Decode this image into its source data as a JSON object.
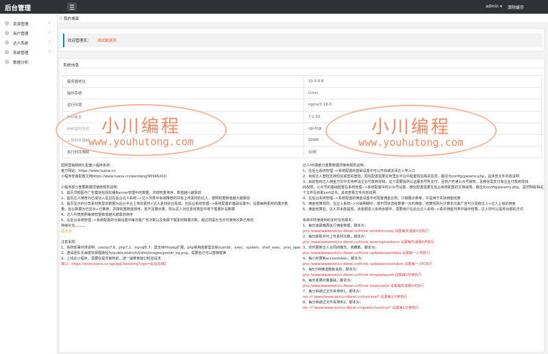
{
  "topbar": {
    "brand": "后台管理",
    "user": "admin",
    "user_caret": "▾",
    "clear_cache": "清除缓存"
  },
  "sidebar": {
    "items": [
      {
        "icon": "◎",
        "label": "资源管理",
        "arrow": "›"
      },
      {
        "icon": "◎",
        "label": "用户管理",
        "arrow": "›"
      },
      {
        "icon": "◎",
        "label": "达人系统",
        "arrow": "›"
      },
      {
        "icon": "◎",
        "label": "系统管理",
        "arrow": "›"
      },
      {
        "icon": "◎",
        "label": "数据分析",
        "arrow": ""
      }
    ]
  },
  "breadcrumb": {
    "icon": "○",
    "label": "我的桌面"
  },
  "welcome": {
    "prefix": "欢迎管理员：",
    "name": "测试数据员"
  },
  "panel": {
    "title": "系统信息",
    "table": [
      {
        "k": "服务器地址",
        "v": "10.0.0.8"
      },
      {
        "k": "操作系统",
        "v": "Linux"
      },
      {
        "k": "运行环境",
        "v": "nginx/1.18.0"
      },
      {
        "k": "PHP版本",
        "v": "7.2.33"
      },
      {
        "k": "PHP运行方式",
        "v": "cgi-fcgi"
      },
      {
        "k": "上传附件限制",
        "v": "500M"
      },
      {
        "k": "执行时间限制",
        "v": "30秒"
      }
    ]
  },
  "left_col": {
    "lines": [
      {
        "t": "团购营销跳转扎配套小程序系统：",
        "c": ""
      },
      {
        "t": "官方网站：https://www.tuana.cn",
        "c": ""
      },
      {
        "t": "小程序安装配置文档https://www.tuana.cn/wendang/90946202/",
        "c": ""
      },
      {
        "t": "",
        "c": "gap"
      },
      {
        "t": "小程序部分重要数据项使用规则说明：",
        "c": ""
      },
      {
        "t": "1、首页顶部图与广告模块包括轮播Banner管理中的数据，并按权重排序，数值越小越靠前",
        "c": ""
      },
      {
        "t": "2、首页达人推荐为已成功入驻且在后台达人系统-->达人列表中有被推荐的并有上传素材的达人，按照权重数值越大越靠前",
        "c": ""
      },
      {
        "t": "3、首页显示的分享素材类型的数据为后台平台上传的素材+达人素材综合而成，在后台系统管理-->系统配置的基础设置中，设置每种素材的展示数",
        "c": ""
      },
      {
        "t": "量。后台数据为已显示+已推荐，并按权重数值排序，若不足展示量，则从达人对应素材类型中按下载量补充数据",
        "c": ""
      },
      {
        "t": "4、达人列表按照每按权重数值越大越靠前排序",
        "c": ""
      },
      {
        "t": "5、在后台系统管理-->系统配置的分销设置中每日看广告次数以及免费下载素材数量次数，超过则提示当日可使用次数已用完",
        "c": ""
      },
      {
        "t": "持续补充。。。。。。",
        "c": ""
      },
      {
        "t": "😊😊😊",
        "c": "emoji"
      },
      {
        "t": "",
        "c": "gap"
      },
      {
        "t": "注意事项：",
        "c": ""
      },
      {
        "t": "1、系统部署环境说明：centos7.6、php7.2、mysql5.7、需支持ffmpeg扩展、php禁用函数需去掉scandir、exec、system、shell_exec、proc_open",
        "c": ""
      },
      {
        "t": "2、邀请团队长海报背景图路径为/public/static/h5/dist/images/poster_bg.png，需要自己可以替换替换",
        "c": ""
      },
      {
        "t": "3、上线必小程序，需要在提交审核前，选一遍菜单接口检验请求",
        "c": ""
      },
      {
        "t": "接口：https://www.tuana.cn/api/qqCheckImg?sign=dj3jJ3j4EJ",
        "c": "red"
      }
    ]
  },
  "right_col": {
    "lines": [
      {
        "t": "达人H5端部分重要数据项使用规则说明：",
        "c": ""
      },
      {
        "t": "1、在后台系统管理-->系统配置的基础设置中可以开启或关闭达人申入口",
        "c": ""
      },
      {
        "t": "2、目前达人登陆支持短信或密码登陆，短信配置需要在阿里云平台中配置短信相关信息，路径为config/params.php，具体查文件内容说明",
        "c": ""
      },
      {
        "t": "3、目前暂时达人佣金方式中支持申请企业付款到零钱，这个需要提供认证服务号所支付，且商户开通公众号授权，且微信需支付有企业付款到零钱",
        "c": ""
      },
      {
        "t": "的权限，公众号的基础配置在系统管理-->系统配置中的公众号设置，微信配置需要在后台系统配置的文档说明，路径为config/params.php，需然明有相关文档",
        "c": ""
      },
      {
        "t": "个文件及获取cert证书，具体查看文件内容说明",
        "c": ""
      },
      {
        "t": "4、在后台系统管理-->系统配置的佣金设置中可配置佣金比例，只做展示参考，不是用于实际佣金结算",
        "c": ""
      },
      {
        "t": "5、佣金结算规则，在达人系统-->分销明细中，按不同状态结算某一天的佣金，结算规则为计算本次最广告可分润收达人+达人上级的佣金",
        "c": ""
      },
      {
        "t": "6、佣金结算后，达人并未能提现，该金额进入系统余额中，需要用户在后台达人系统-->真实佣金列表中操作结算，达人则可以提现出额的方式",
        "c": ""
      },
      {
        "t": "",
        "c": "gap"
      },
      {
        "t": "系统中所使用到的定时任务脚本：",
        "c": ""
      },
      {
        "t": "1、每日凌晨晚再执行佣金数据，脚本为：",
        "c": ""
      },
      {
        "t": "php /www/wwwroot/cs-dkewl.cn/think refreshmoney 设置每天凌晨0点执行",
        "c": "red"
      },
      {
        "t": "2、每日获取并可上传素材次数，脚本为：",
        "c": ""
      },
      {
        "t": "php /www/wwwroot/cs-dkewl.cn/think reverfuploadnum 设置每天凌晨0点执行",
        "c": "red"
      },
      {
        "t": "3、定时更新达人合同的曝光、收藏数，脚本为：",
        "c": ""
      },
      {
        "t": "php /www/wwwroot/cs-dkewl.cn/think updateexpertdata 设置每一小时执行",
        "c": "red"
      },
      {
        "t": "4、每小时更新accesstoken，脚本为：",
        "c": ""
      },
      {
        "t": "php /www/wwwroot/cs-dkewl.cn/think updateaccesstoken 设置每一小时执行",
        "c": "red"
      },
      {
        "t": "5、每5分钟推送模板消息，脚本为：",
        "c": ""
      },
      {
        "t": "php /www/wwwroot/cs-dkewl.cn/think templatepush 设置每5分钟执行",
        "c": "red"
      },
      {
        "t": "6、每天收更红量基础，脚本为：",
        "c": ""
      },
      {
        "t": "php /www/wwwroot/cs-dkewl.cn/think cleancache 设置每天凌晨0点执行",
        "c": "red"
      },
      {
        "t": "7、每分钟通过文件夹排序1，脚本为：",
        "c": ""
      },
      {
        "t": "rm -rf /www/wwwroot/cs-dkewl.cn/runtime/* 设置每1分钟执行",
        "c": "red"
      },
      {
        "t": "8、每分钟通过文件夹排序2，脚本为：",
        "c": ""
      },
      {
        "t": "rm -rf /www/wwwroot/cs-dkewl.cn/public/runtime/* 设置每1分钟执行",
        "c": "red"
      }
    ]
  },
  "watermark": {
    "line1": "小川编程",
    "line2": "www.youhutong.com"
  }
}
